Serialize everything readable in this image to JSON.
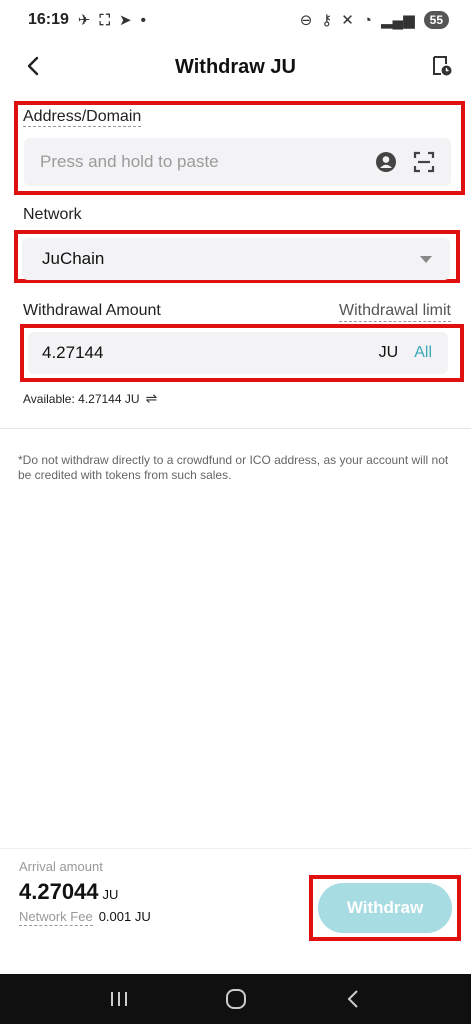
{
  "status_bar": {
    "time": "16:19",
    "battery": "55"
  },
  "header": {
    "title": "Withdraw JU"
  },
  "address": {
    "label": "Address/Domain",
    "placeholder": "Press and hold to paste"
  },
  "network": {
    "label": "Network",
    "value": "JuChain"
  },
  "amount": {
    "label": "Withdrawal Amount",
    "limit_link": "Withdrawal limit",
    "value": "4.27144",
    "unit": "JU",
    "all_label": "All",
    "available": "Available: 4.27144 JU"
  },
  "notice": "*Do not withdraw directly to a crowdfund or ICO address, as your account will not be credited with tokens from such sales.",
  "summary": {
    "arrival_label": "Arrival amount",
    "arrival_value": "4.27044",
    "arrival_unit": "JU",
    "fee_label": "Network Fee",
    "fee_value": "0.001 JU"
  },
  "withdraw_button": "Withdraw",
  "colors": {
    "accent": "#3aa9b8",
    "button_disabled": "#a8dce3",
    "highlight": "#e01010"
  },
  "icons": {
    "back": "chevron-left-icon",
    "history": "history-icon",
    "contact": "contact-icon",
    "scan": "scan-icon",
    "dropdown": "caret-down-icon",
    "swap": "swap-icon"
  }
}
